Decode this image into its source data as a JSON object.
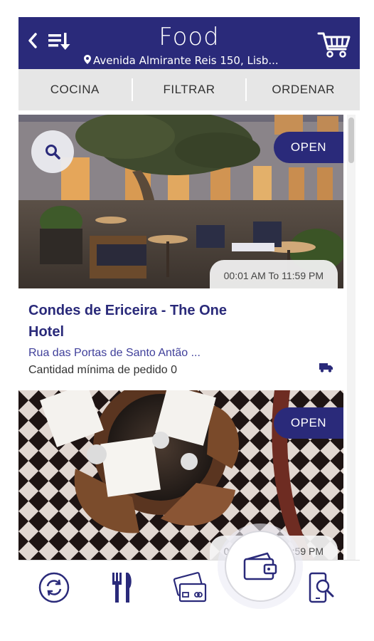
{
  "header": {
    "title": "Food",
    "address": "Avenida Almirante Reis 150, Lisb..."
  },
  "submenu": {
    "tabs": [
      {
        "label": "COCINA"
      },
      {
        "label": "FILTRAR"
      },
      {
        "label": "ORDENAR"
      }
    ]
  },
  "restaurants": [
    {
      "status": "OPEN",
      "hours": "00:01 AM To 11:59 PM",
      "name": "Condes de Ericeira - The One Hotel",
      "street": "Rua das Portas de Santo Antão ...",
      "minimum_order": "Cantidad mínima de pedido 0"
    },
    {
      "status": "OPEN",
      "hours": "00:01 AM To 11:59 PM"
    }
  ],
  "icons": {
    "back": "chevron-left-icon",
    "sort": "sort-icon",
    "cart": "cart-icon",
    "pin": "location-pin-icon",
    "search": "search-icon",
    "truck": "delivery-truck-icon",
    "nav": [
      "refresh-icon",
      "cutlery-icon",
      "payment-cards-icon",
      "wallet-icon",
      "phone-search-icon"
    ]
  },
  "colors": {
    "primary": "#2a2a7a",
    "submenu_bg": "#e6e6e6"
  }
}
